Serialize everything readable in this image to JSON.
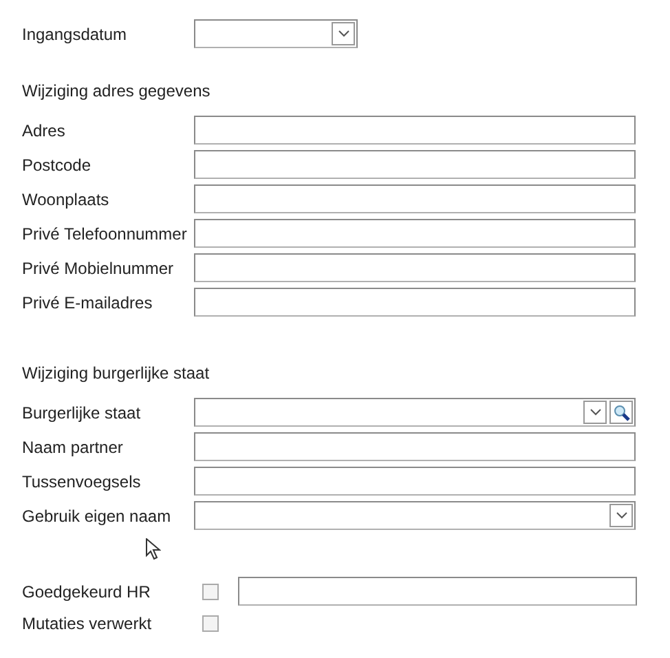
{
  "sections": [
    {
      "fields": [
        {
          "kind": "date",
          "label": "Ingangsdatum"
        }
      ]
    },
    {
      "heading": "Wijziging adres gegevens",
      "fields": [
        {
          "kind": "text",
          "label": "Adres"
        },
        {
          "kind": "text",
          "label": "Postcode"
        },
        {
          "kind": "text",
          "label": "Woonplaats"
        },
        {
          "kind": "text",
          "label": "Privé Telefoonnummer"
        },
        {
          "kind": "text",
          "label": "Privé Mobielnummer"
        },
        {
          "kind": "text",
          "label": "Privé E-mailadres"
        }
      ]
    },
    {
      "heading": "Wijziging burgerlijke staat",
      "fields": [
        {
          "kind": "lookup",
          "label": "Burgerlijke staat"
        },
        {
          "kind": "text",
          "label": "Naam partner"
        },
        {
          "kind": "text",
          "label": "Tussenvoegsels"
        },
        {
          "kind": "dropdown",
          "label": "Gebruik eigen naam"
        }
      ]
    },
    {
      "fields": [
        {
          "kind": "checkbox-text",
          "label": "Goedgekeurd HR",
          "checked": false
        },
        {
          "kind": "checkbox",
          "label": "Mutaties verwerkt",
          "checked": false
        }
      ]
    }
  ]
}
